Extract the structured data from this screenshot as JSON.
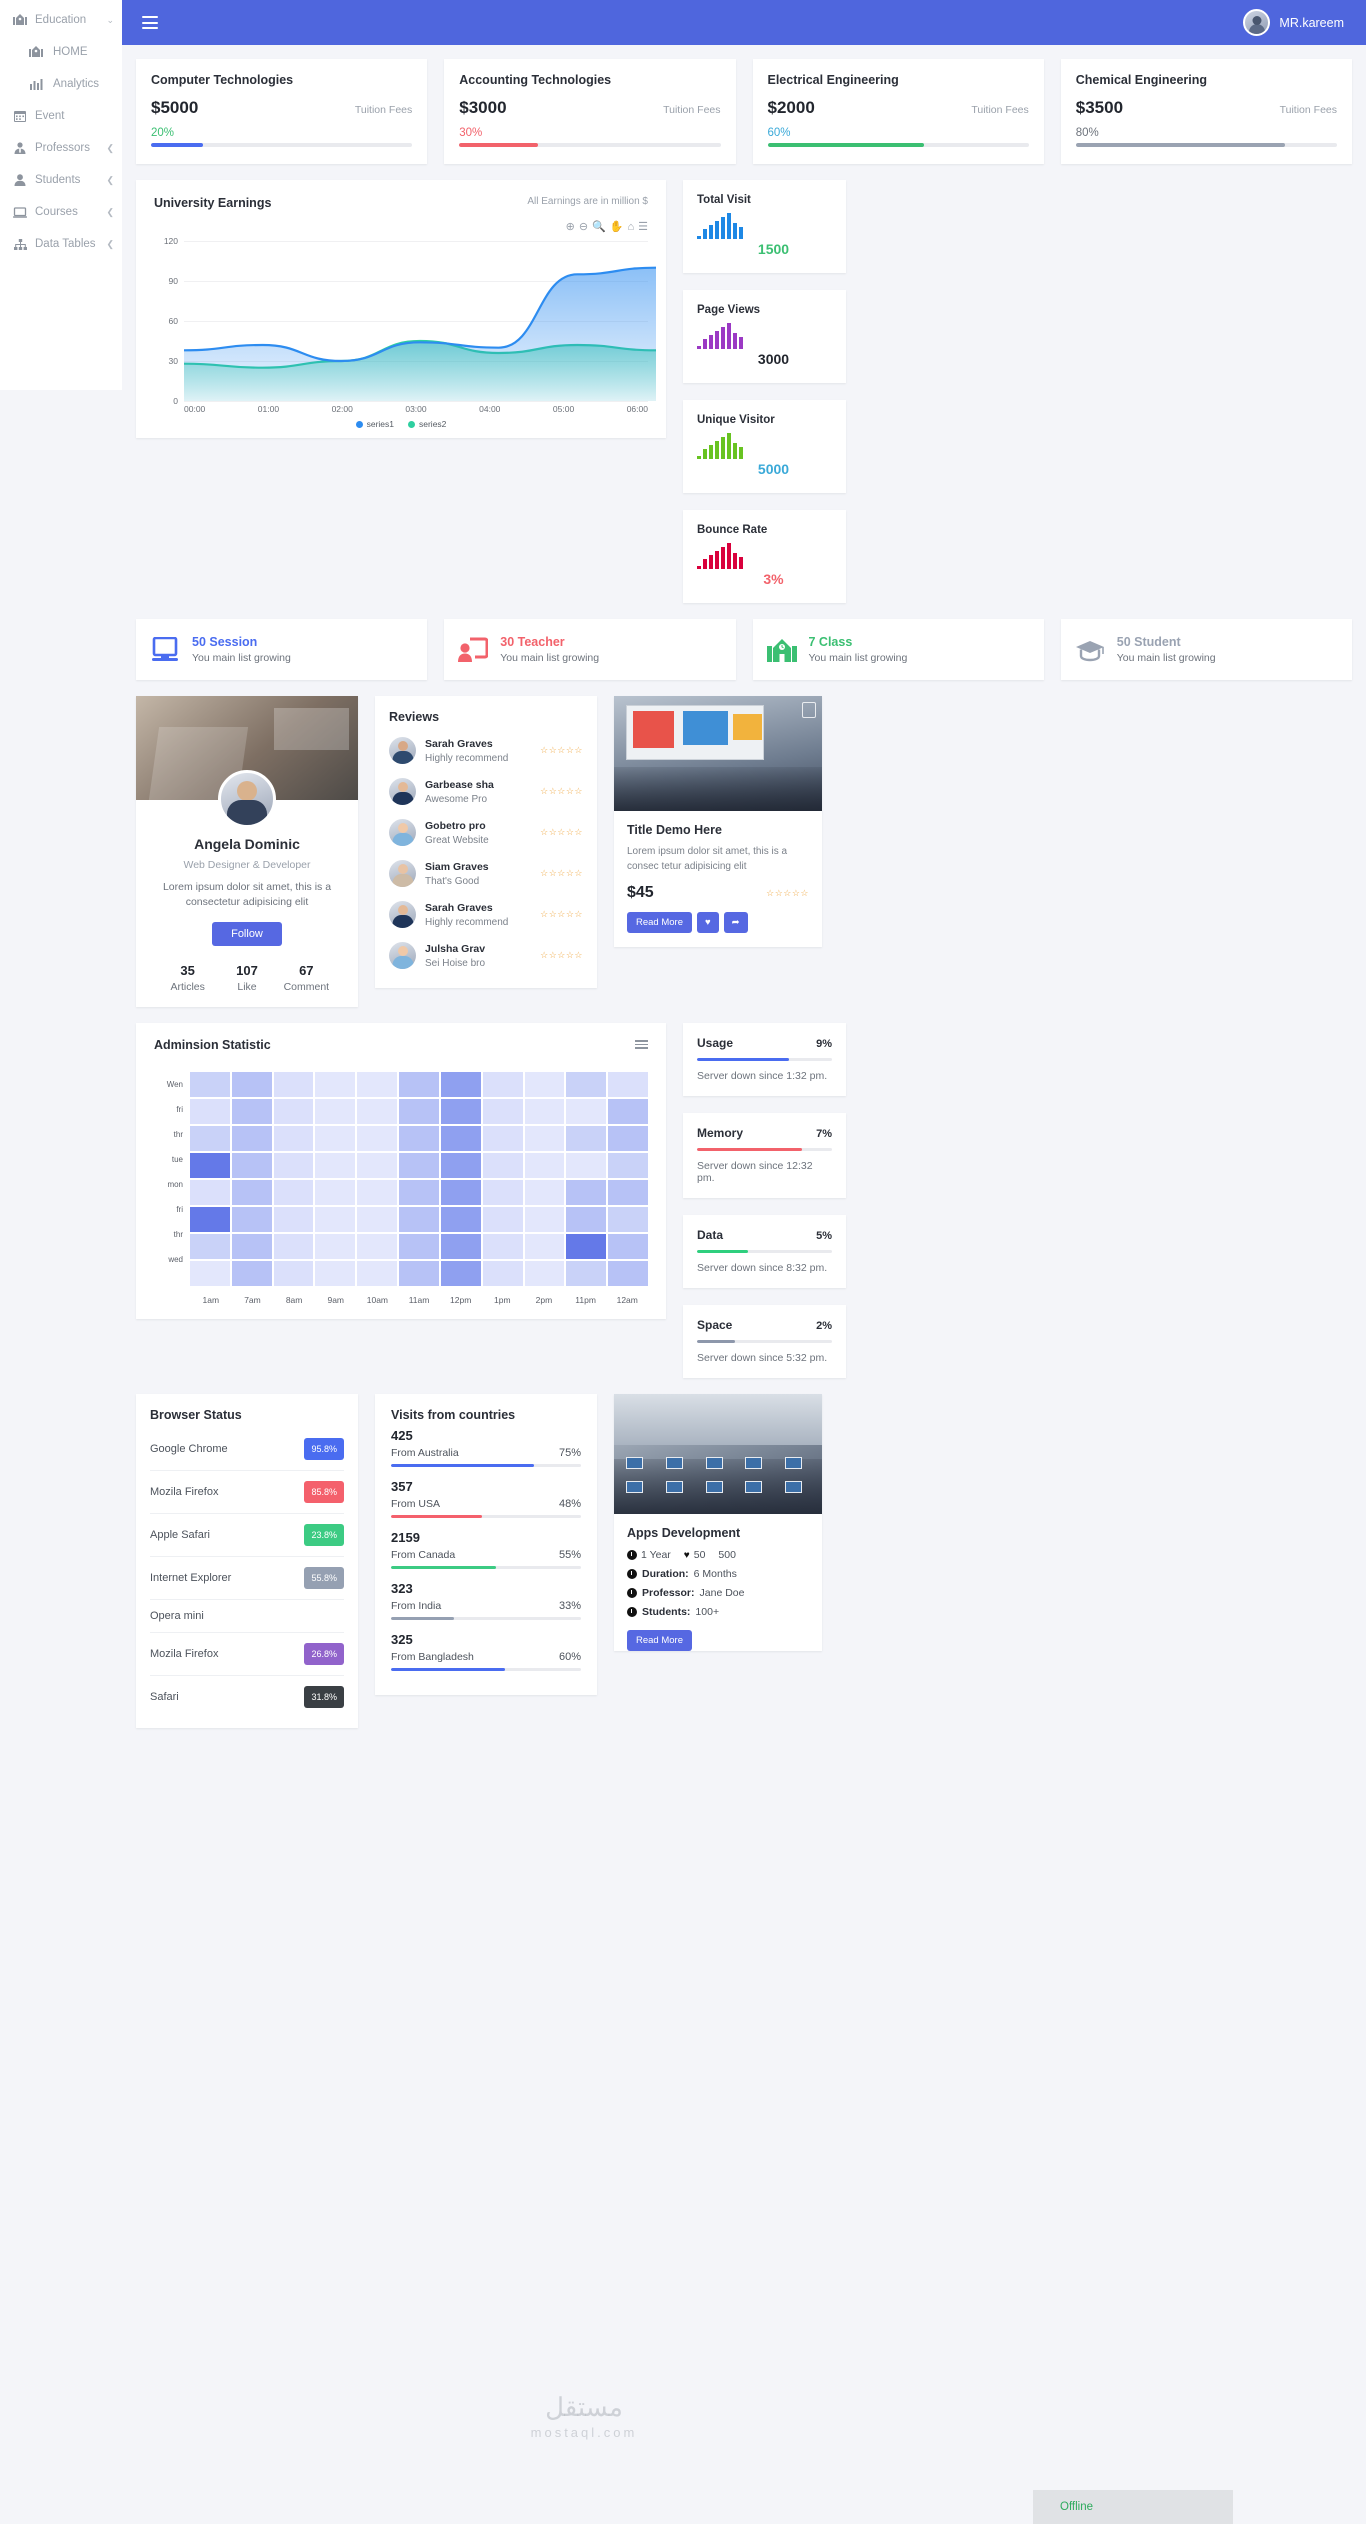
{
  "sidebar": {
    "items": [
      {
        "label": "Education",
        "icon": "school-icon",
        "caret": "chevron-down-icon",
        "sub": false
      },
      {
        "label": "HOME",
        "icon": "school-icon",
        "caret": "",
        "sub": true
      },
      {
        "label": "Analytics",
        "icon": "bar-chart-icon",
        "caret": "",
        "sub": true
      },
      {
        "label": "Event",
        "icon": "calendar-icon",
        "caret": "",
        "sub": false
      },
      {
        "label": "Professors",
        "icon": "user-tie-icon",
        "caret": "chevron-left-icon",
        "sub": false
      },
      {
        "label": "Students",
        "icon": "user-icon",
        "caret": "chevron-left-icon",
        "sub": false
      },
      {
        "label": "Courses",
        "icon": "laptop-icon",
        "caret": "chevron-left-icon",
        "sub": false
      },
      {
        "label": "Data Tables",
        "icon": "sitemap-icon",
        "caret": "chevron-left-icon",
        "sub": false
      }
    ]
  },
  "topbar": {
    "menu_icon": "hamburger-icon",
    "user_name": "MR.kareem",
    "bg_color": "#4f66dd"
  },
  "fee_cards": [
    {
      "title": "Computer Technologies",
      "amount": "$5000",
      "sub": "Tuition Fees",
      "percent": "20%",
      "value": 20,
      "color": "#4a6cf0",
      "pct_color": "#3bbf72"
    },
    {
      "title": "Accounting Technologies",
      "amount": "$3000",
      "sub": "Tuition Fees",
      "percent": "30%",
      "value": 30,
      "color": "#f2626b",
      "pct_color": "#f2626b"
    },
    {
      "title": "Electrical Engineering",
      "amount": "$2000",
      "sub": "Tuition Fees",
      "percent": "60%",
      "value": 60,
      "color": "#3bbf72",
      "pct_color": "#3aa9d8"
    },
    {
      "title": "Chemical Engineering",
      "amount": "$3500",
      "sub": "Tuition Fees",
      "percent": "80%",
      "value": 80,
      "color": "#9aa3b2",
      "pct_color": "#6d737c"
    }
  ],
  "earnings": {
    "title": "University Earnings",
    "note": "All Earnings are in million $",
    "toolbar_icons": [
      "zoom-in-icon",
      "zoom-out-icon",
      "selection-zoom-icon",
      "panning-icon",
      "reset-zoom-icon",
      "menu-icon"
    ]
  },
  "chart_data": {
    "type": "area",
    "title": "University Earnings",
    "subtitle": "All Earnings are in million $",
    "x": [
      "00:00",
      "01:00",
      "02:00",
      "03:00",
      "04:00",
      "05:00",
      "06:00"
    ],
    "xlabel": "",
    "ylabel": "",
    "ylim": [
      0,
      120
    ],
    "yticks": [
      0,
      30,
      60,
      90,
      120
    ],
    "grid": true,
    "legend_position": "bottom",
    "series": [
      {
        "name": "series1",
        "color": "#2d8cf0",
        "values": [
          38,
          42,
          30,
          44,
          40,
          95,
          100
        ]
      },
      {
        "name": "series2",
        "color": "#2ecfa0",
        "values": [
          28,
          25,
          30,
          45,
          36,
          42,
          38
        ]
      }
    ]
  },
  "mini_stats": [
    {
      "title": "Total Visit",
      "value": "1500",
      "bar_color": "#1e88e5",
      "value_color": "#3bbf72",
      "bars": [
        3,
        10,
        14,
        18,
        22,
        26,
        16,
        12
      ]
    },
    {
      "title": "Page Views",
      "value": "3000",
      "bar_color": "#9b39c4",
      "value_color": "#22262e",
      "bars": [
        3,
        10,
        14,
        18,
        22,
        26,
        16,
        12
      ]
    },
    {
      "title": "Unique Visitor",
      "value": "5000",
      "bar_color": "#68c321",
      "value_color": "#3aa9d8",
      "bars": [
        3,
        10,
        14,
        18,
        22,
        26,
        16,
        12
      ]
    },
    {
      "title": "Bounce Rate",
      "value": "3%",
      "bar_color": "#d9003c",
      "value_color": "#f2626b",
      "bars": [
        3,
        10,
        14,
        18,
        22,
        26,
        16,
        12
      ]
    }
  ],
  "info_cards": [
    {
      "num": "50 Session",
      "sub": "You main list growing",
      "color": "#4a6cf0",
      "icon": "monitor-icon"
    },
    {
      "num": "30 Teacher",
      "sub": "You main list growing",
      "color": "#f2626b",
      "icon": "teacher-icon"
    },
    {
      "num": "7 Class",
      "sub": "You main list growing",
      "color": "#3bbf72",
      "icon": "school-building-icon"
    },
    {
      "num": "50 Student",
      "sub": "You main list growing",
      "color": "#9aa3b2",
      "icon": "graduation-cap-icon"
    }
  ],
  "profile": {
    "name": "Angela Dominic",
    "role": "Web Designer & Developer",
    "desc": "Lorem ipsum dolor sit amet, this is a consectetur adipisicing elit",
    "follow_label": "Follow",
    "stats": [
      {
        "num": "35",
        "label": "Articles"
      },
      {
        "num": "107",
        "label": "Like"
      },
      {
        "num": "67",
        "label": "Comment"
      }
    ]
  },
  "reviews": {
    "title": "Reviews",
    "stars": "☆☆☆☆☆",
    "items": [
      {
        "name": "Sarah Graves",
        "text": "Highly recommend",
        "skin": "#d8a886",
        "cloth": "#2e4a6e"
      },
      {
        "name": "Garbease sha",
        "text": "Awesome Pro",
        "skin": "#e4b996",
        "cloth": "#1f3559"
      },
      {
        "name": "Gobetro pro",
        "text": "Great Website",
        "skin": "#f0c9a8",
        "cloth": "#7fb4dd"
      },
      {
        "name": "Siam Graves",
        "text": "That's Good",
        "skin": "#e8c3a4",
        "cloth": "#cdbba6"
      },
      {
        "name": "Sarah Graves",
        "text": "Highly recommend",
        "skin": "#e4b996",
        "cloth": "#1f3559"
      },
      {
        "name": "Julsha Grav",
        "text": "Sei Hoise bro",
        "skin": "#f0c9a8",
        "cloth": "#7fb4dd"
      }
    ]
  },
  "demo": {
    "title": "Title Demo Here",
    "desc": "Lorem ipsum dolor sit amet, this is a consec tetur adipisicing elit",
    "price": "$45",
    "stars": "☆☆☆☆☆",
    "read_more": "Read More",
    "like_icon": "heart-icon",
    "share_icon": "share-icon"
  },
  "admission": {
    "title": "Adminsion Statistic",
    "menu_icon": "hamburger-menu-icon",
    "rows": [
      "Wen",
      "fri",
      "thr",
      "tue",
      "mon",
      "fri",
      "thr",
      "wed"
    ],
    "cols": [
      "1am",
      "7am",
      "8am",
      "9am",
      "10am",
      "11am",
      "12pm",
      "1pm",
      "2pm",
      "11pm",
      "12am"
    ],
    "cells": [
      [
        3,
        4,
        2,
        1,
        1,
        4,
        5,
        2,
        1,
        3,
        2
      ],
      [
        2,
        4,
        2,
        1,
        1,
        4,
        5,
        2,
        1,
        1,
        4
      ],
      [
        3,
        4,
        2,
        1,
        1,
        4,
        5,
        2,
        1,
        3,
        4
      ],
      [
        6,
        4,
        2,
        1,
        1,
        4,
        5,
        2,
        1,
        1,
        3
      ],
      [
        2,
        4,
        2,
        1,
        1,
        4,
        5,
        2,
        1,
        4,
        4
      ],
      [
        6,
        4,
        2,
        1,
        1,
        4,
        5,
        2,
        1,
        4,
        3
      ],
      [
        3,
        4,
        2,
        1,
        1,
        4,
        5,
        2,
        1,
        6,
        4
      ],
      [
        1,
        4,
        2,
        1,
        1,
        4,
        5,
        2,
        1,
        3,
        4
      ]
    ]
  },
  "usage_cards": [
    {
      "title": "Usage",
      "percent": "9%",
      "value": 68,
      "color": "#4a6cf0",
      "status": "Server down since 1:32 pm."
    },
    {
      "title": "Memory",
      "percent": "7%",
      "value": 78,
      "color": "#f2626b",
      "status": "Server down since 12:32 pm."
    },
    {
      "title": "Data",
      "percent": "5%",
      "value": 38,
      "color": "#2ecf7e",
      "status": "Server down since 8:32 pm."
    },
    {
      "title": "Space",
      "percent": "2%",
      "value": 28,
      "color": "#8d97ab",
      "status": "Server down since 5:32 pm."
    }
  ],
  "browser_status": {
    "title": "Browser Status",
    "items": [
      {
        "name": "Google Chrome",
        "pct": "95.8%",
        "color": "#4a6cf0"
      },
      {
        "name": "Mozila Firefox",
        "pct": "85.8%",
        "color": "#f4606c"
      },
      {
        "name": "Apple Safari",
        "pct": "23.8%",
        "color": "#3ccb83"
      },
      {
        "name": "Internet Explorer",
        "pct": "55.8%",
        "color": "#95a0b2"
      },
      {
        "name": "Opera mini",
        "pct": "",
        "color": ""
      },
      {
        "name": "Mozila Firefox",
        "pct": "26.8%",
        "color": "#9163cb"
      },
      {
        "name": "Safari",
        "pct": "31.8%",
        "color": "#3a3f44"
      }
    ]
  },
  "visits": {
    "title": "Visits from countries",
    "items": [
      {
        "num": "425",
        "country": "From Australia",
        "pct": "75%",
        "value": 75,
        "color": "#4a6cf0"
      },
      {
        "num": "357",
        "country": "From USA",
        "pct": "48%",
        "value": 48,
        "color": "#f4606c"
      },
      {
        "num": "2159",
        "country": "From Canada",
        "pct": "55%",
        "value": 55,
        "color": "#3ccb83"
      },
      {
        "num": "323",
        "country": "From India",
        "pct": "33%",
        "value": 33,
        "color": "#95a0b2"
      },
      {
        "num": "325",
        "country": "From Bangladesh",
        "pct": "60%",
        "value": 60,
        "color": "#4a6cf0"
      }
    ]
  },
  "apps": {
    "title": "Apps Development",
    "year": "1 Year",
    "likes": "50",
    "views": "500",
    "duration_label": "Duration:",
    "duration_value": "6 Months",
    "professor_label": "Professor:",
    "professor_value": "Jane Doe",
    "students_label": "Students:",
    "students_value": "100+",
    "read_more": "Read More"
  },
  "offline": {
    "label": "Offline"
  },
  "watermark": {
    "line1": "مستقل",
    "line2": "mostaql.com"
  }
}
